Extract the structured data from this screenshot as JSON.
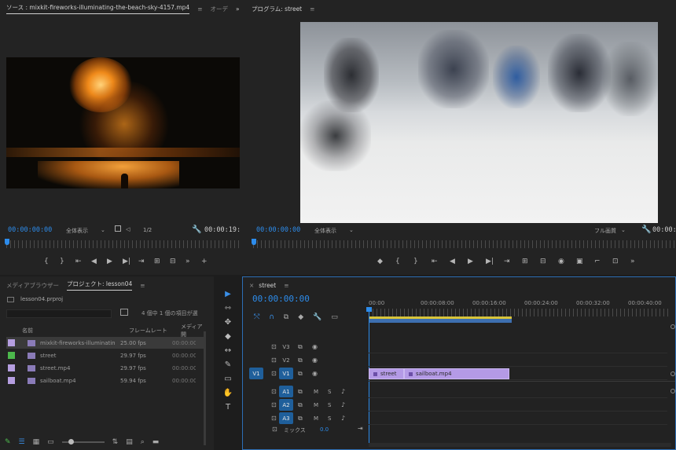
{
  "source_monitor": {
    "tab_label": "ソース : mixkit-fireworks-illuminating-the-beach-sky-4157.mp4",
    "tab_menu": "≡",
    "tab2_label": "オーデ",
    "overflow": "»",
    "timecode_left": "00:00:00:00",
    "fit_label": "全体表示",
    "resolution": "1/2",
    "timecode_right": "00:00:19:",
    "controls": [
      "{",
      "}",
      "⇤",
      "◀",
      "▶",
      "▶|",
      "⇥",
      "⊞",
      "⊟",
      "»",
      "+"
    ]
  },
  "program_monitor": {
    "tab_label": "プログラム: street",
    "tab_menu": "≡",
    "timecode_left": "00:00:00:00",
    "fit_label": "全体表示",
    "resolution": "フル画質",
    "timecode_right": "00:00:",
    "controls": [
      "◆",
      "{",
      "}",
      "⇤",
      "◀",
      "▶",
      "▶|",
      "⇥",
      "⊞",
      "⊟",
      "◉",
      "▣",
      "⌐",
      "⊡",
      "»"
    ]
  },
  "project_panel": {
    "tabs": [
      "メディアブラウザー",
      "プロジェクト: lesson04"
    ],
    "tab_menu": "≡",
    "project_file": "lesson04.prproj",
    "search_placeholder": "",
    "item_count": "4 個中 1 個の項目が選",
    "headers": [
      "名前",
      "フレームレート",
      "メディア開"
    ],
    "rows": [
      {
        "name": "mixkit-fireworks-illuminatin",
        "fps": "25.00 fps",
        "start": "00:00:00",
        "color": "#b59ee0",
        "selected": true
      },
      {
        "name": "street",
        "fps": "29.97 fps",
        "start": "00:00:00",
        "color": "#4cb84c",
        "selected": false
      },
      {
        "name": "street.mp4",
        "fps": "29.97 fps",
        "start": "00:00:00",
        "color": "#b59ee0",
        "selected": false
      },
      {
        "name": "sailboat.mp4",
        "fps": "59.94 fps",
        "start": "00:00:00",
        "color": "#b59ee0",
        "selected": false
      }
    ]
  },
  "tools": [
    "▶",
    "⇿",
    "✥",
    "◆",
    "↔",
    "✎",
    "▭",
    "✋",
    "T"
  ],
  "timeline": {
    "sequence_name": "street",
    "tab_menu": "≡",
    "timecode": "00:00:00:00",
    "ruler_labels": [
      "00:00",
      "00:00:08:00",
      "00:00:16:00",
      "00:00:24:00",
      "00:00:32:00",
      "00:00:40:00"
    ],
    "tracks": [
      {
        "label": "V3",
        "target": "",
        "blue": false
      },
      {
        "label": "V2",
        "target": "",
        "blue": false
      },
      {
        "label": "V1",
        "target": "V1",
        "blue": true
      },
      {
        "label": "A1",
        "target": "",
        "blue": true
      },
      {
        "label": "A2",
        "target": "",
        "blue": true
      },
      {
        "label": "A3",
        "target": "",
        "blue": true
      }
    ],
    "mix_label": "ミックス",
    "mix_value": "0.0",
    "clips": [
      {
        "name": "street"
      },
      {
        "name": "sailboat.mp4"
      }
    ]
  }
}
